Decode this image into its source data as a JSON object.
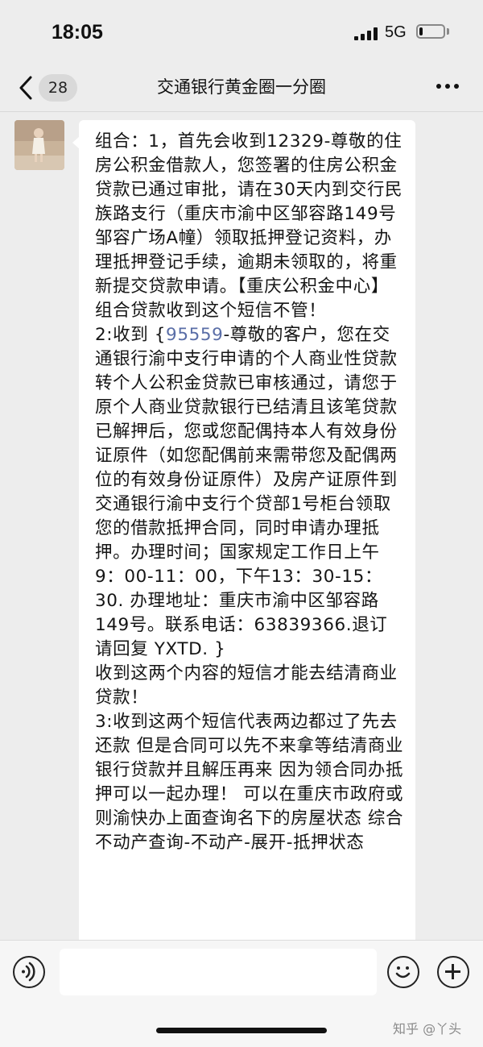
{
  "status_bar": {
    "time": "18:05",
    "network": "5G",
    "battery_level": 0.15
  },
  "header": {
    "back_badge": "28",
    "title": "交通银行黄金圈一分圈",
    "back_icon": "chevron-left-icon",
    "more_icon": "more-dots-icon"
  },
  "message": {
    "part1": "组合：1，首先会收到12329-尊敬的住房公积金借款人，您签署的住房公积金贷款已通过审批，请在30天内到交行民族路支行（重庆市渝中区邹容路149号邹容广场A幢）领取抵押登记资料，办理抵押登记手续，逾期未领取的，将重新提交贷款申请。【重庆公积金中心】组合贷款收到这个短信不管！",
    "part2_prefix": "2:收到 {",
    "part2_link": "95559",
    "part2_rest": "-尊敬的客户，您在交通银行渝中支行申请的个人商业性贷款转个人公积金贷款已审核通过，请您于原个人商业贷款银行已结清且该笔贷款已解押后，您或您配偶持本人有效身份证原件（如您配偶前来需带您及配偶两位的有效身份证原件）及房产证原件到交通银行渝中支行个贷部1号柜台领取您的借款抵押合同，同时申请办理抵押。办理时间；国家规定工作日上午9：00-11：00，下午13：30-15：30. 办理地址：重庆市渝中区邹容路149号。联系电话：63839366.退订请回复 YXTD. }",
    "part2_note": "收到这两个内容的短信才能去结清商业贷款！",
    "part3": "3:收到这两个短信代表两边都过了先去还款 但是合同可以先不来拿等结清商业银行贷款并且解压再来 因为领合同办抵押可以一起办理！ 可以在重庆市政府或则渝快办上面查询名下的房屋状态 综合不动产查询-不动产-展开-抵押状态"
  },
  "input_bar": {
    "voice_icon": "voice-icon",
    "emoji_icon": "emoji-icon",
    "plus_icon": "plus-icon",
    "input_value": ""
  },
  "watermark": "知乎 @丫头",
  "colors": {
    "background": "#ededed",
    "bubble": "#ffffff",
    "link": "#5a6ea7"
  }
}
